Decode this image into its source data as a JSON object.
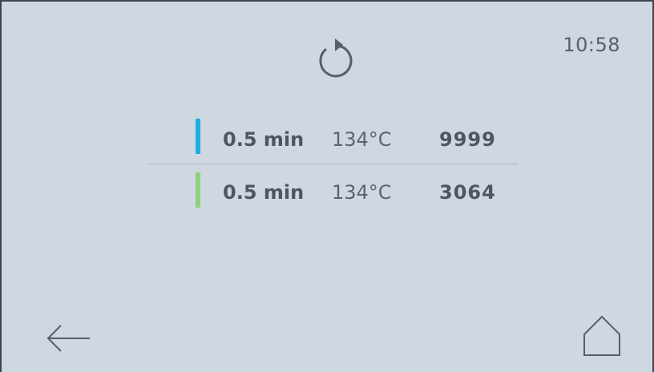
{
  "header": {
    "clock": "10:58",
    "status_icon": "cycle-refresh-icon"
  },
  "programs": [
    {
      "duration": "0.5 min",
      "temperature": "134°C",
      "count": "9999",
      "indicator_color": "#1eaee4"
    },
    {
      "duration": "0.5 min",
      "temperature": "134°C",
      "count": "3064",
      "indicator_color": "#8fd07c"
    }
  ],
  "footer": {
    "back_icon": "arrow-left-icon",
    "home_icon": "home-icon"
  },
  "colors": {
    "background": "#cfd7e1",
    "text": "#4f5964",
    "divider": "#a6b6c6"
  }
}
